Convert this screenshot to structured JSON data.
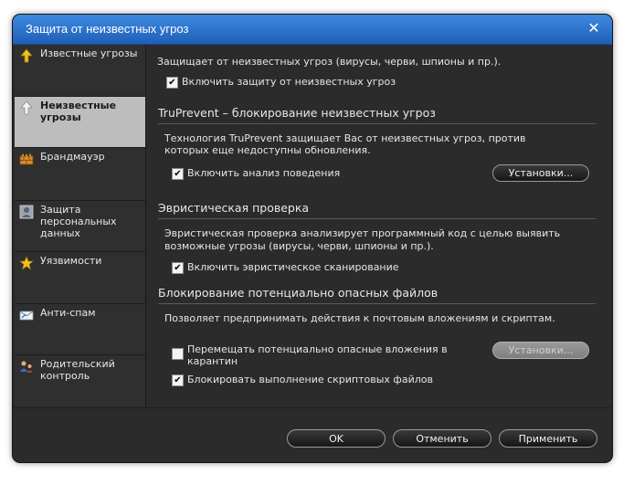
{
  "window": {
    "title": "Защита от неизвестных угроз",
    "close_glyph": "✕"
  },
  "sidebar": {
    "items": [
      {
        "label": "Известные угрозы",
        "icon": "arrow-up-icon",
        "active": false
      },
      {
        "label": "Неизвестные\nугрозы",
        "icon": "arrow-up-icon",
        "active": true
      },
      {
        "label": "Брандмауэр",
        "icon": "firewall-icon",
        "active": false
      },
      {
        "label": "Защита\nперсональных\nданных",
        "icon": "personal-data-icon",
        "active": false
      },
      {
        "label": "Уязвимости",
        "icon": "star-icon",
        "active": false
      },
      {
        "label": "Анти-спам",
        "icon": "mail-icon",
        "active": false
      },
      {
        "label": "Родительский\nконтроль",
        "icon": "parental-control-icon",
        "active": false
      }
    ]
  },
  "main": {
    "intro": "Защищает от неизвестных угроз (вирусы, черви, шпионы и пр.).",
    "enable_protection": {
      "label": "Включить защиту от неизвестных угроз",
      "checked": true
    },
    "truprevent": {
      "heading": "TruPrevent – блокирование неизвестных угроз",
      "description_line1": "Технология TruPrevent защищает Вас от неизвестных угроз, против",
      "description_line2": "которых еще недоступны обновления.",
      "behavior_check": {
        "label": "Включить анализ поведения",
        "checked": true
      },
      "settings_button": "Установки..."
    },
    "heuristic": {
      "heading": "Эвристическая проверка",
      "description_line1": "Эвристическая проверка анализирует программный код с целью выявить",
      "description_line2": "возможные угрозы (вирусы, черви, шпионы и пр.).",
      "scan_check": {
        "label": "Включить эвристическое сканирование",
        "checked": true
      }
    },
    "blocking": {
      "heading": "Блокирование потенциально опасных файлов",
      "description": "Позволяет предпринимать действия к почтовым вложениям и скриптам.",
      "quarantine_check": {
        "label_line1": "Перемещать потенциально опасные вложения в",
        "label_line2": "карантин",
        "checked": false
      },
      "settings_button": "Установки...",
      "scripts_check": {
        "label": "Блокировать выполнение скриптовых файлов",
        "checked": true
      }
    }
  },
  "footer": {
    "ok": "OK",
    "cancel": "Отменить",
    "apply": "Применить"
  },
  "colors": {
    "titlebar": "#2f74d0",
    "background": "#2b2b2b",
    "active_item": "#bdbdbd"
  }
}
